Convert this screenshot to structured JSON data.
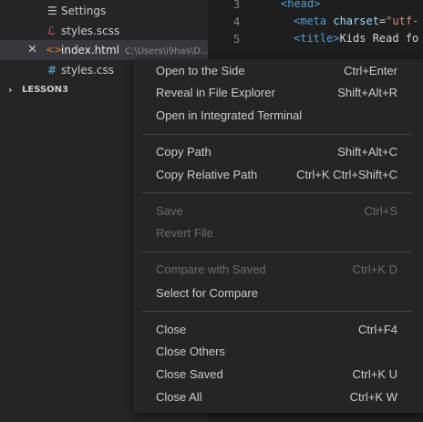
{
  "explorer": {
    "items": [
      {
        "label": "Settings",
        "icon": "list-icon"
      },
      {
        "label": "styles.scss",
        "icon": "sass-icon"
      },
      {
        "label": "index.html",
        "path": "C:\\Users\\i9has\\D...",
        "icon": "html-icon"
      },
      {
        "label": "styles.css",
        "icon": "css-hash-icon"
      }
    ],
    "section": "LESSON3"
  },
  "editor": {
    "line_numbers": [
      "3",
      "4",
      "5"
    ],
    "lines": [
      {
        "tag_open": "<head>"
      },
      {
        "tag": "<meta",
        "attr": " charset",
        "eq": "=",
        "str": "\"utf-"
      },
      {
        "tag": "<title>",
        "text": "Kids Read fo"
      }
    ]
  },
  "context_menu": {
    "groups": [
      [
        {
          "label": "Open to the Side",
          "shortcut": "Ctrl+Enter",
          "enabled": true
        },
        {
          "label": "Reveal in File Explorer",
          "shortcut": "Shift+Alt+R",
          "enabled": true
        },
        {
          "label": "Open in Integrated Terminal",
          "shortcut": "",
          "enabled": true
        }
      ],
      [
        {
          "label": "Copy Path",
          "shortcut": "Shift+Alt+C",
          "enabled": true
        },
        {
          "label": "Copy Relative Path",
          "shortcut": "Ctrl+K Ctrl+Shift+C",
          "enabled": true
        }
      ],
      [
        {
          "label": "Save",
          "shortcut": "Ctrl+S",
          "enabled": false
        },
        {
          "label": "Revert File",
          "shortcut": "",
          "enabled": false
        }
      ],
      [
        {
          "label": "Compare with Saved",
          "shortcut": "Ctrl+K D",
          "enabled": false
        },
        {
          "label": "Select for Compare",
          "shortcut": "",
          "enabled": true
        }
      ],
      [
        {
          "label": "Close",
          "shortcut": "Ctrl+F4",
          "enabled": true
        },
        {
          "label": "Close Others",
          "shortcut": "",
          "enabled": true
        },
        {
          "label": "Close Saved",
          "shortcut": "Ctrl+K U",
          "enabled": true
        },
        {
          "label": "Close All",
          "shortcut": "Ctrl+K W",
          "enabled": true
        }
      ]
    ]
  }
}
